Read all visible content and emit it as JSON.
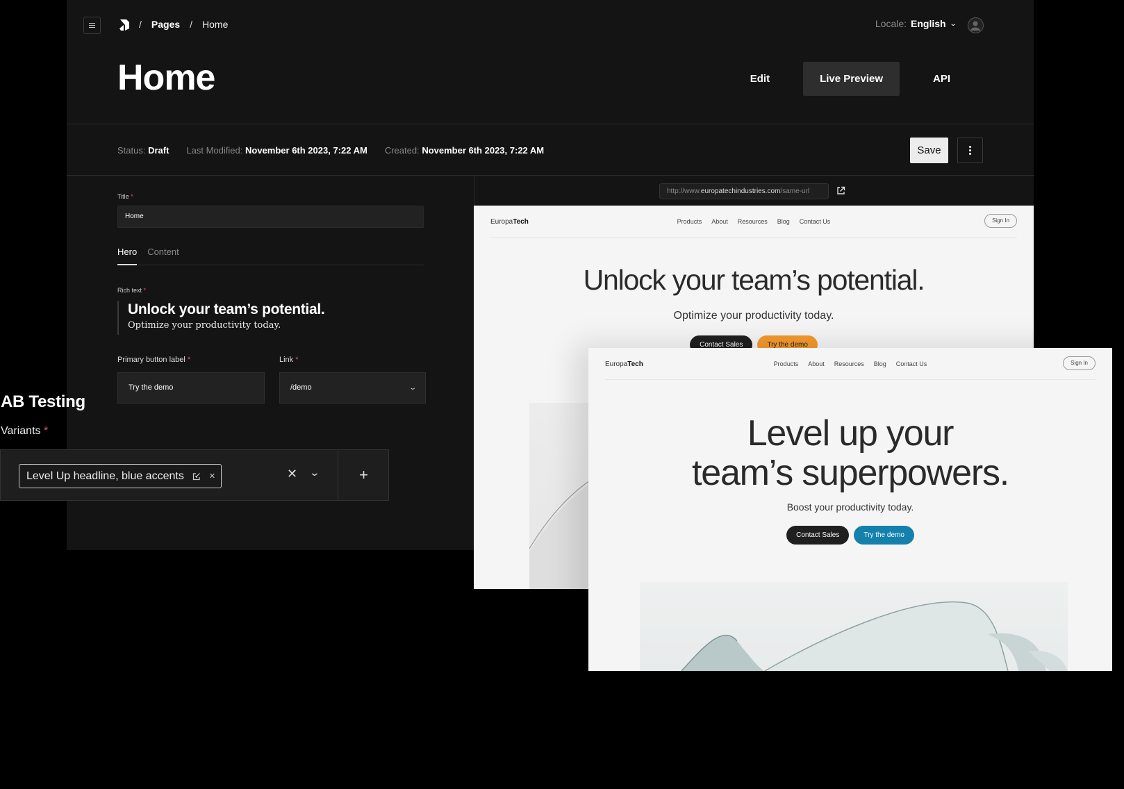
{
  "breadcrumb": {
    "root": "Pages",
    "current": "Home",
    "separator": "/"
  },
  "locale": {
    "label": "Locale:",
    "value": "English"
  },
  "page": {
    "title": "Home"
  },
  "view_tabs": [
    {
      "label": "Edit",
      "active": false
    },
    {
      "label": "Live Preview",
      "active": true
    },
    {
      "label": "API",
      "active": false
    }
  ],
  "meta": {
    "status_label": "Status:",
    "status_value": "Draft",
    "modified_label": "Last Modified:",
    "modified_value": "November 6th 2023, 7:22 AM",
    "created_label": "Created:",
    "created_value": "November 6th 2023, 7:22 AM"
  },
  "actions": {
    "save_label": "Save"
  },
  "form": {
    "title_label": "Title",
    "title_value": "Home",
    "tabs": [
      {
        "label": "Hero",
        "active": true
      },
      {
        "label": "Content",
        "active": false
      }
    ],
    "rich_text_label": "Rich text",
    "rich_heading": "Unlock your team’s potential.",
    "rich_sub": "Optimize your productivity today.",
    "primary_button_label": "Primary button label",
    "primary_button_value": "Try the demo",
    "link_label": "Link",
    "link_value": "/demo",
    "required_mark": "*"
  },
  "ab_testing": {
    "title": "AB Testing",
    "variants_label": "Variants",
    "selected_variant": "Level Up headline, blue accents"
  },
  "preview_url": {
    "prefix": "http://www.",
    "domain": "europatechindustries.com",
    "path": "/same-url"
  },
  "site": {
    "brand_light": "Europa",
    "brand_bold": "Tech",
    "nav": [
      "Products",
      "About",
      "Resources",
      "Blog",
      "Contact Us"
    ],
    "signin": "Sign In",
    "secondary_cta": "Contact Sales"
  },
  "variant_a": {
    "headline": "Unlock your team’s potential.",
    "subhead": "Optimize your productivity today.",
    "primary_cta": "Try the demo",
    "accent_color": "#f49a2c"
  },
  "variant_b": {
    "headline_line1": "Level up your",
    "headline_line2": "team’s superpowers.",
    "subhead": "Boost your productivity today.",
    "primary_cta": "Try the demo",
    "accent_color": "#1381ac"
  }
}
